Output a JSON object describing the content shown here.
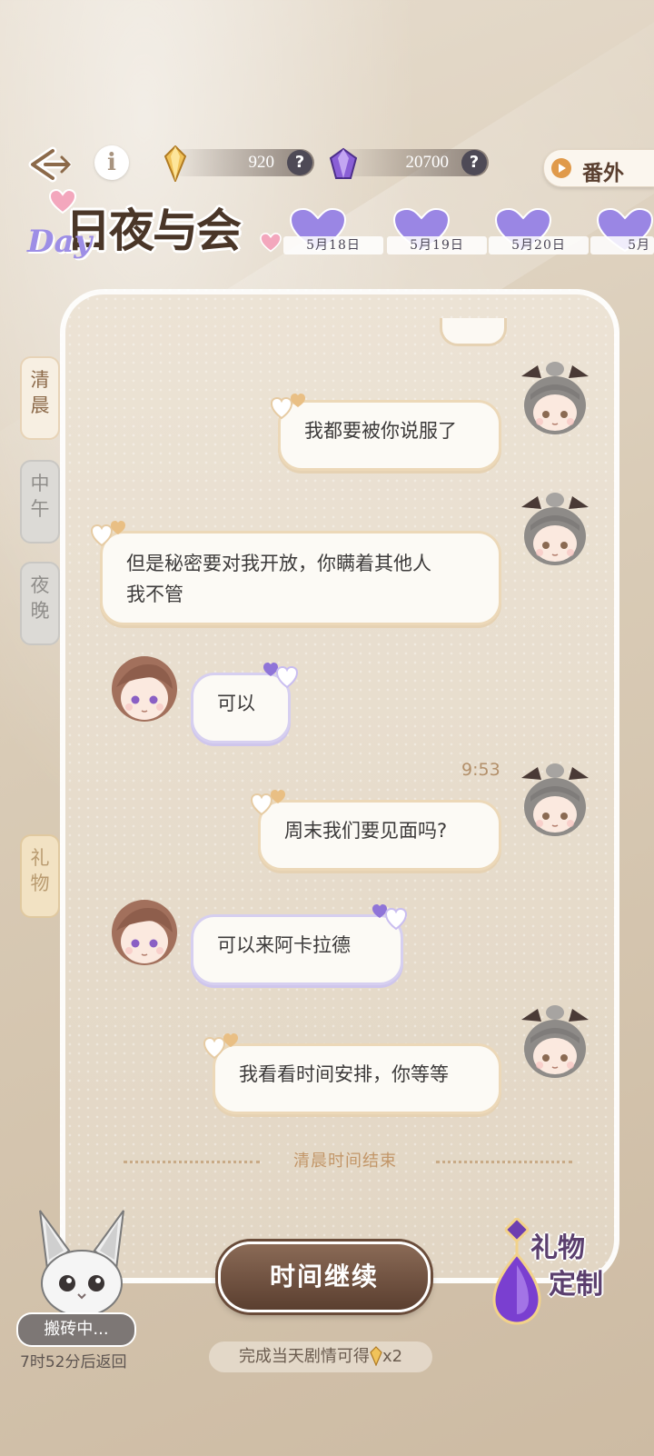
{
  "topbar": {
    "gold_amount": "920",
    "purple_amount": "20700",
    "help_symbol": "?",
    "extra_button": "番外",
    "info_symbol": "i"
  },
  "logo": {
    "title": "日夜与会",
    "day_text": "Day"
  },
  "dates": [
    {
      "label": "5月18日"
    },
    {
      "label": "5月19日"
    },
    {
      "label": "5月20日"
    },
    {
      "label": "5月"
    }
  ],
  "side_tabs": {
    "morning": "清晨",
    "noon": "中午",
    "night": "夜晚",
    "gift": "礼物"
  },
  "messages": [
    {
      "sender": "player",
      "text": "我都要被你说服了"
    },
    {
      "sender": "player",
      "text_line1": "但是秘密要对我开放，你瞒着其他人",
      "text_line2": "我不管"
    },
    {
      "sender": "npc",
      "text": "可以"
    },
    {
      "sender": "player",
      "time": "9:53",
      "text": "周末我们要见面吗?"
    },
    {
      "sender": "npc",
      "text": "可以来阿卡拉德"
    },
    {
      "sender": "player",
      "text": "我看看时间安排，你等等"
    }
  ],
  "end_label": "清晨时间结束",
  "continue_button": "时间继续",
  "reward_note": {
    "text": "完成当天剧情可得",
    "suffix": "x2"
  },
  "pet": {
    "status": "搬砖中...",
    "return": "7时52分后返回"
  },
  "gift_custom": {
    "line1": "礼物",
    "line2": "定制"
  },
  "colors": {
    "player_border": "#ecd8b8",
    "npc_border": "#d6cff0",
    "accent_purple": "#9d8ee6",
    "button_brown": "#5b3f30"
  }
}
